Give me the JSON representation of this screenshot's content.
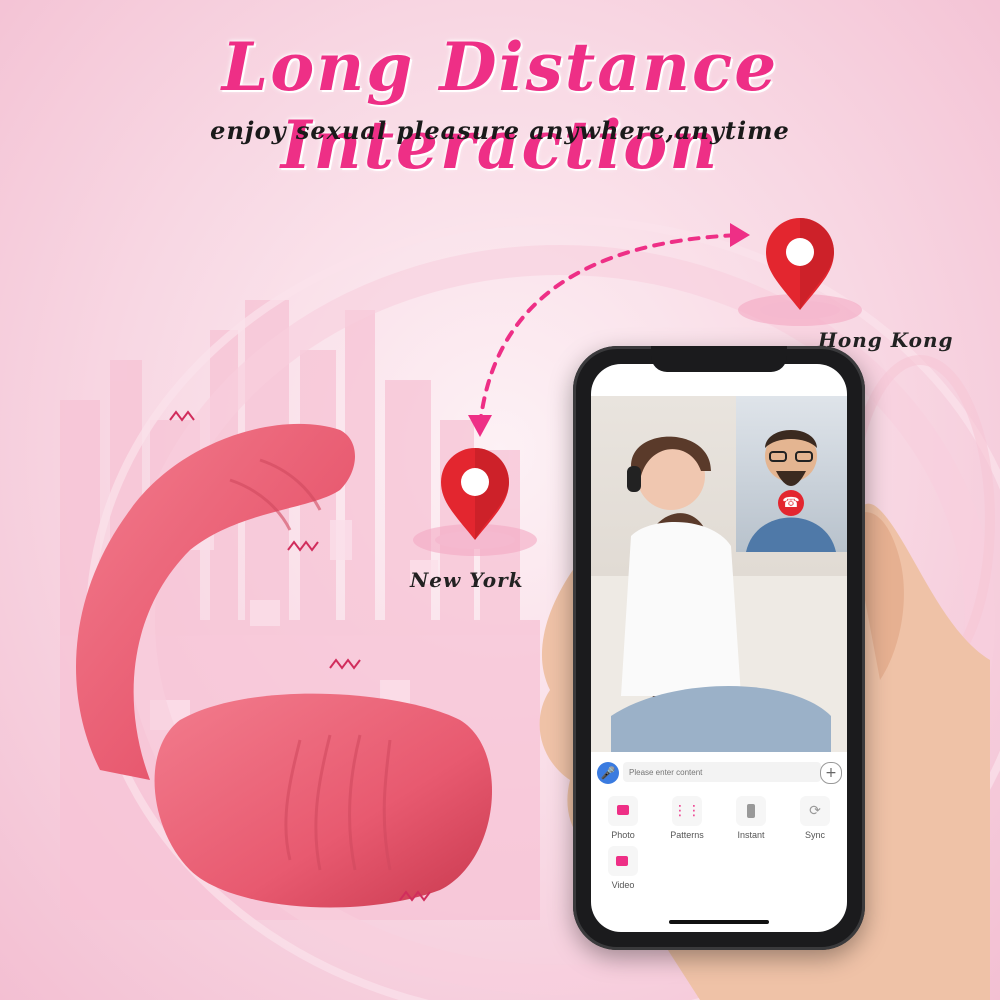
{
  "headline": "Long Distance Interaction",
  "subheadline": "enjoy sexual pleasure anywhere,anytime",
  "locations": {
    "origin": "New York",
    "destination": "Hong Kong"
  },
  "app": {
    "input_placeholder": "Please enter content",
    "features": [
      {
        "label": "Photo",
        "icon": "photo-icon"
      },
      {
        "label": "Patterns",
        "icon": "sound-wave-icon"
      },
      {
        "label": "Instant",
        "icon": "vibration-icon"
      },
      {
        "label": "Sync",
        "icon": "sync-icon"
      },
      {
        "label": "Video",
        "icon": "video-camera-icon"
      }
    ]
  },
  "colors": {
    "headline": "#ee2f86",
    "pin": "#e3262f",
    "product": "#e85a70",
    "accent": "#e8337d"
  }
}
